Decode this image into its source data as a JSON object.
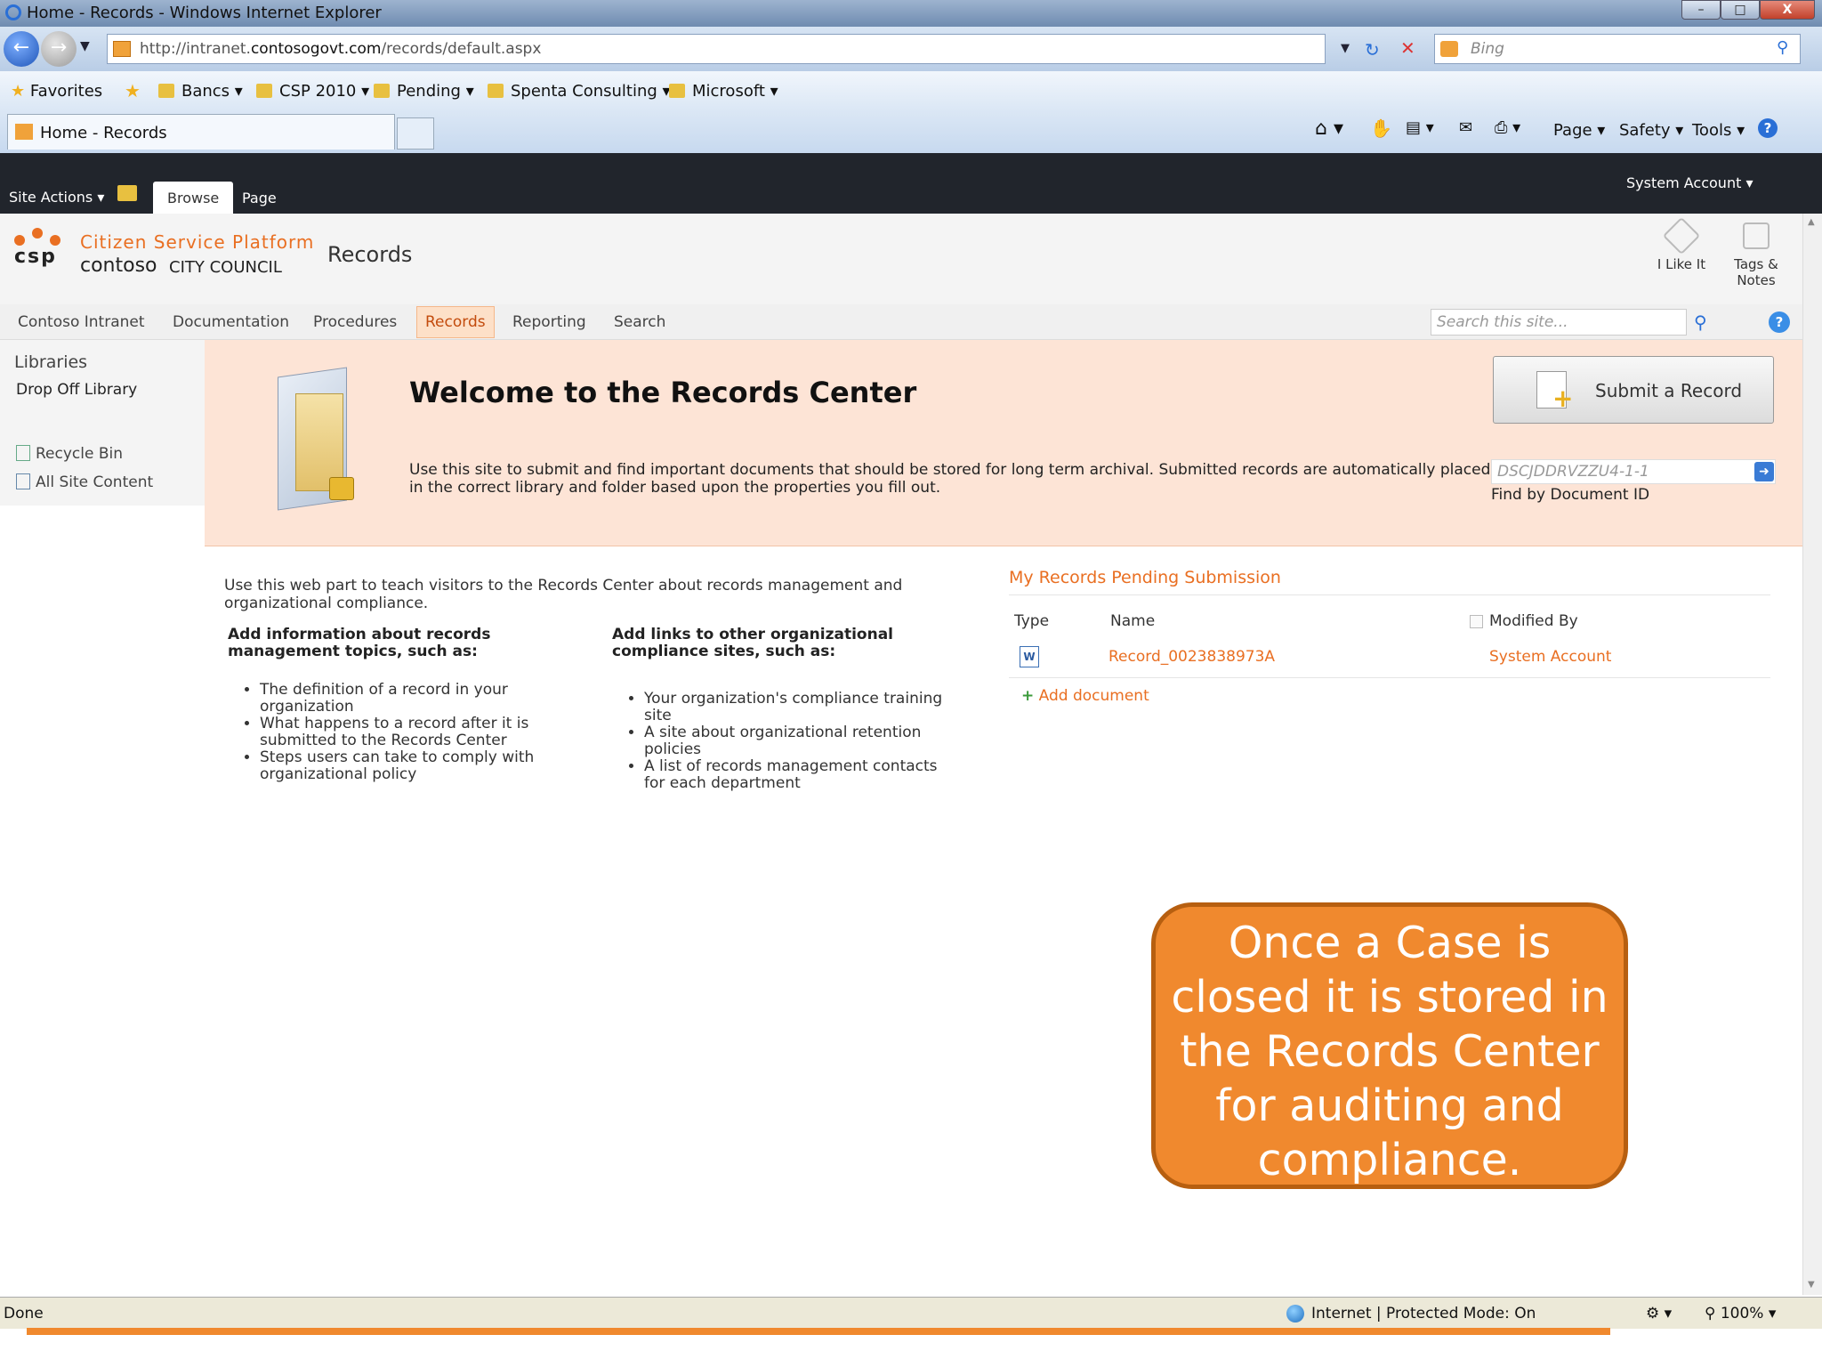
{
  "window": {
    "title": "Home - Records - Windows Internet Explorer",
    "controls": [
      "–",
      "□",
      "X"
    ]
  },
  "browser": {
    "address": {
      "prefix": "http://intranet.",
      "domain": "contosogovt.com",
      "path": "/records/default.aspx"
    },
    "search_provider": "Bing"
  },
  "favorites_bar": {
    "favorites_label": "Favorites",
    "folders": [
      "Bancs",
      "CSP 2010",
      "Pending",
      "Spenta Consulting",
      "Microsoft"
    ]
  },
  "tab": {
    "title": "Home - Records"
  },
  "command_bar": {
    "page": "Page",
    "safety": "Safety",
    "tools": "Tools"
  },
  "ribbon": {
    "site_actions": "Site Actions",
    "tabs": [
      "Browse",
      "Page"
    ],
    "user": "System Account"
  },
  "header": {
    "logo_letters": "csp",
    "platform": "Citizen Service Platform",
    "org": "contoso",
    "council": "CITY COUNCIL",
    "site_title": "Records",
    "i_like_it": "I Like It",
    "tags_notes_1": "Tags &",
    "tags_notes_2": "Notes"
  },
  "top_nav": {
    "items": [
      "Contoso Intranet",
      "Documentation",
      "Procedures",
      "Records",
      "Reporting",
      "Search"
    ],
    "active": "Records",
    "search_placeholder": "Search this site..."
  },
  "left_nav": {
    "heading": "Libraries",
    "libraries": [
      "Drop Off Library"
    ],
    "recycle_bin": "Recycle Bin",
    "all_site_content": "All Site Content"
  },
  "banner": {
    "title": "Welcome to the Records Center",
    "description": "Use this site to submit and find important documents that should be stored for long term archival. Submitted records are automatically placed in the correct library and folder based upon the properties you fill out.",
    "submit_button": "Submit a Record",
    "document_id": "DSCJDDRVZZU4-1-1",
    "find_by_id": "Find by Document ID"
  },
  "intro_webpart": {
    "intro": "Use this web part to teach visitors to the Records Center about records management and organizational compliance.",
    "col1_heading": "Add information about records management topics, such as:",
    "col1_items": [
      "The definition of a record in your organization",
      "What happens to a record after it is submitted to the Records Center",
      "Steps users can take to comply with organizational policy"
    ],
    "col2_heading": "Add links to other organizational compliance sites, such as:",
    "col2_items": [
      "Your organization's compliance training site",
      "A site about organizational retention policies",
      "A list of records management contacts for each department"
    ]
  },
  "pending": {
    "title": "My Records Pending Submission",
    "columns": [
      "Type",
      "Name",
      "Modified By"
    ],
    "rows": [
      {
        "name": "Record_0023838973A",
        "modified_by": "System Account"
      }
    ],
    "add_document": "Add document"
  },
  "callout": {
    "lines": [
      "Once a Case is",
      "closed it is stored in",
      "the Records Center",
      "for auditing and",
      "compliance."
    ]
  },
  "status": {
    "left": "Done",
    "zone": "Internet | Protected Mode: On",
    "zoom": "100%"
  },
  "colors": {
    "accent": "#e96f22",
    "banner": "#fde4d6",
    "callout": "#f0892e",
    "ribbon": "#21252c"
  }
}
